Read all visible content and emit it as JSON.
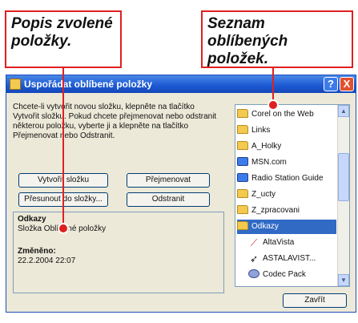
{
  "callouts": {
    "left": "Popis zvolené položky.",
    "right": "Seznam oblíbených položek."
  },
  "window": {
    "title": "Uspořádat oblíbené položky",
    "help_label": "?",
    "close_label": "X"
  },
  "description": "Chcete-li vytvořit novou složku, klepněte na tlačítko Vytvořit složku. Pokud chcete přejmenovat nebo odstranit některou položku, vyberte ji a klepněte na tlačítko Přejmenovat nebo Odstranit.",
  "buttons": {
    "create_folder": "Vytvořit složku",
    "rename": "Přejmenovat",
    "move_to_folder": "Přesunout do složky...",
    "delete": "Odstranit",
    "close": "Zavřít"
  },
  "info_panel": {
    "name": "Odkazy",
    "type": "Složka Oblíbené položky",
    "modified_label": "Změněno:",
    "modified_value": "22.2.2004 22:07"
  },
  "favorites": [
    {
      "label": "Corel on the Web",
      "icon": "folder-icon",
      "indent": false,
      "selected": false
    },
    {
      "label": "Links",
      "icon": "folder-icon",
      "indent": false,
      "selected": false
    },
    {
      "label": "A_Holky",
      "icon": "folder-icon",
      "indent": false,
      "selected": false
    },
    {
      "label": "MSN.com",
      "icon": "link-icon",
      "indent": false,
      "selected": false
    },
    {
      "label": "Radio Station Guide",
      "icon": "link-icon",
      "indent": false,
      "selected": false
    },
    {
      "label": "Z_ucty",
      "icon": "folder-icon",
      "indent": false,
      "selected": false
    },
    {
      "label": "Z_zpracovani",
      "icon": "folder-icon",
      "indent": false,
      "selected": false
    },
    {
      "label": "Odkazy",
      "icon": "folder-icon",
      "indent": false,
      "selected": true
    },
    {
      "label": "AltaVista",
      "icon": "altavista-icon",
      "indent": true,
      "selected": false
    },
    {
      "label": "ASTALAVIST...",
      "icon": "astalavista-icon",
      "indent": true,
      "selected": false
    },
    {
      "label": "Codec Pack",
      "icon": "codec-icon",
      "indent": true,
      "selected": false
    }
  ],
  "scrollbar": {
    "up": "▲",
    "down": "▼"
  },
  "colors": {
    "callout_border": "#e02020",
    "titlebar": "#1b58d2",
    "selection": "#316ac5",
    "dialog_bg": "#ece9d8"
  }
}
